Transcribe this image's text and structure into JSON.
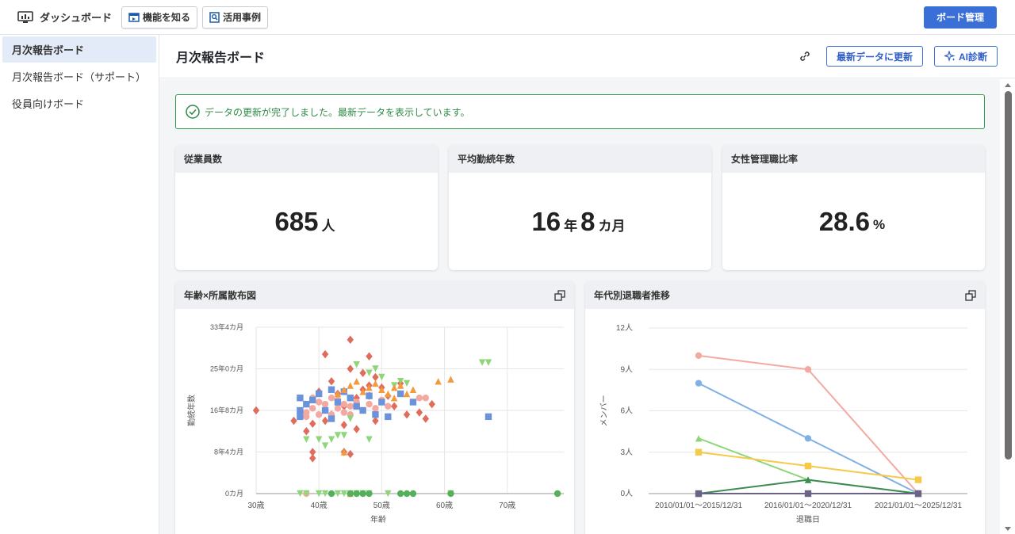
{
  "topbar": {
    "app_title": "ダッシュボード",
    "features_btn": "機能を知る",
    "cases_btn": "活用事例",
    "manage_btn": "ボード管理"
  },
  "sidebar": {
    "items": [
      {
        "label": "月次報告ボード",
        "active": true
      },
      {
        "label": "月次報告ボード（サポート）",
        "active": false
      },
      {
        "label": "役員向けボード",
        "active": false
      }
    ]
  },
  "main": {
    "title": "月次報告ボード",
    "refresh_btn": "最新データに更新",
    "ai_btn": "AI診断",
    "notice": "データの更新が完了しました。最新データを表示しています。"
  },
  "kpis": [
    {
      "title": "従業員数",
      "value": "685",
      "unit": "人"
    },
    {
      "title": "平均勤続年数",
      "value1": "16",
      "unit1": "年",
      "value2": "8",
      "unit2": "カ月"
    },
    {
      "title": "女性管理職比率",
      "value": "28.6",
      "unit": "%"
    }
  ],
  "colors": {
    "accent": "#3a6fd8",
    "success": "#2e9a4a"
  },
  "chart_data": [
    {
      "type": "scatter",
      "title": "年齢×所属散布図",
      "xlabel": "年齢",
      "ylabel": "勤続年数",
      "xlim": [
        30,
        79
      ],
      "ylim": [
        0,
        400
      ],
      "x_ticks": [
        {
          "v": 30,
          "label": "30歳"
        },
        {
          "v": 40,
          "label": "40歳"
        },
        {
          "v": 50,
          "label": "50歳"
        },
        {
          "v": 60,
          "label": "60歳"
        },
        {
          "v": 70,
          "label": "70歳"
        }
      ],
      "y_ticks": [
        {
          "v": 0,
          "label": "0カ月"
        },
        {
          "v": 100,
          "label": "8年4カ月"
        },
        {
          "v": 200,
          "label": "16年8カ月"
        },
        {
          "v": 300,
          "label": "25年0カ月"
        },
        {
          "v": 400,
          "label": "33年4カ月"
        }
      ],
      "series": [
        {
          "color": "#e06d5c",
          "marker": "diamond",
          "points": [
            [
              30,
              200
            ],
            [
              36,
              175
            ],
            [
              38,
              150
            ],
            [
              39,
              168
            ],
            [
              40,
              245
            ],
            [
              41,
              335
            ],
            [
              41,
              175
            ],
            [
              42,
              270
            ],
            [
              42,
              190
            ],
            [
              43,
              215
            ],
            [
              44,
              210
            ],
            [
              44,
              100
            ],
            [
              44,
              165
            ],
            [
              45,
              370
            ],
            [
              45,
              300
            ],
            [
              45,
              95
            ],
            [
              46,
              230
            ],
            [
              46,
              155
            ],
            [
              47,
              290
            ],
            [
              47,
              250
            ],
            [
              48,
              330
            ],
            [
              48,
              260
            ],
            [
              49,
              280
            ],
            [
              49,
              175
            ],
            [
              50,
              255
            ],
            [
              51,
              235
            ],
            [
              53,
              265
            ],
            [
              54,
              190
            ],
            [
              56,
              195
            ],
            [
              57,
              180
            ],
            [
              58,
              215
            ],
            [
              48,
              235
            ],
            [
              43,
              240
            ],
            [
              52,
              210
            ],
            [
              39,
              85
            ],
            [
              39,
              100
            ]
          ]
        },
        {
          "color": "#f4a9a0",
          "marker": "circle",
          "points": [
            [
              38,
              195
            ],
            [
              38,
              185
            ],
            [
              39,
              230
            ],
            [
              39,
              205
            ],
            [
              40,
              220
            ],
            [
              40,
              190
            ],
            [
              41,
              215
            ],
            [
              41,
              200
            ],
            [
              42,
              230
            ],
            [
              42,
              190
            ],
            [
              43,
              225
            ],
            [
              43,
              205
            ],
            [
              44,
              215
            ],
            [
              44,
              195
            ],
            [
              45,
              210
            ],
            [
              45,
              190
            ],
            [
              46,
              220
            ],
            [
              47,
              200
            ],
            [
              48,
              215
            ],
            [
              49,
              205
            ],
            [
              50,
              225
            ],
            [
              51,
              210
            ],
            [
              56,
              230
            ],
            [
              57,
              230
            ],
            [
              38,
              0
            ]
          ]
        },
        {
          "color": "#6b93dc",
          "marker": "square",
          "points": [
            [
              37,
              200
            ],
            [
              37,
              185
            ],
            [
              38,
              215
            ],
            [
              39,
              225
            ],
            [
              40,
              240
            ],
            [
              41,
              200
            ],
            [
              42,
              250
            ],
            [
              43,
              220
            ],
            [
              44,
              245
            ],
            [
              45,
              230
            ],
            [
              46,
              210
            ],
            [
              47,
              200
            ],
            [
              48,
              235
            ],
            [
              49,
              190
            ],
            [
              50,
              220
            ],
            [
              51,
              185
            ],
            [
              53,
              240
            ],
            [
              55,
              220
            ],
            [
              67,
              185
            ],
            [
              37,
              230
            ],
            [
              42,
              180
            ]
          ]
        },
        {
          "color": "#8ed67a",
          "marker": "triangle-down",
          "points": [
            [
              37,
              0
            ],
            [
              38,
              0
            ],
            [
              40,
              0
            ],
            [
              41,
              0
            ],
            [
              43,
              0
            ],
            [
              44,
              0
            ],
            [
              45,
              0
            ],
            [
              46,
              0
            ],
            [
              47,
              0
            ],
            [
              48,
              0
            ],
            [
              51,
              0
            ],
            [
              38,
              130
            ],
            [
              40,
              130
            ],
            [
              41,
              115
            ],
            [
              42,
              130
            ],
            [
              43,
              140
            ],
            [
              44,
              140
            ],
            [
              45,
              180
            ],
            [
              46,
              310
            ],
            [
              48,
              290
            ],
            [
              49,
              300
            ],
            [
              50,
              280
            ],
            [
              52,
              260
            ],
            [
              54,
              265
            ],
            [
              48,
              130
            ],
            [
              53,
              270
            ],
            [
              61,
              0
            ],
            [
              66,
              315
            ],
            [
              67,
              315
            ]
          ]
        },
        {
          "color": "#f29a3c",
          "marker": "triangle-up",
          "points": [
            [
              43,
              240
            ],
            [
              44,
              250
            ],
            [
              45,
              260
            ],
            [
              46,
              270
            ],
            [
              47,
              245
            ],
            [
              48,
              255
            ],
            [
              49,
              265
            ],
            [
              50,
              250
            ],
            [
              51,
              240
            ],
            [
              52,
              255
            ],
            [
              53,
              260
            ],
            [
              54,
              240
            ],
            [
              55,
              250
            ],
            [
              59,
              270
            ],
            [
              61,
              275
            ],
            [
              44,
              100
            ],
            [
              45,
              0
            ],
            [
              52,
              230
            ]
          ]
        },
        {
          "color": "#55b05a",
          "marker": "circle",
          "points": [
            [
              42,
              0
            ],
            [
              45,
              0
            ],
            [
              46,
              0
            ],
            [
              47,
              0
            ],
            [
              48,
              0
            ],
            [
              53,
              0
            ],
            [
              54,
              0
            ],
            [
              55,
              0
            ],
            [
              61,
              0
            ],
            [
              78,
              0
            ]
          ]
        }
      ]
    },
    {
      "type": "line",
      "title": "年代別退職者推移",
      "xlabel": "退職日",
      "ylabel": "メンバー",
      "categories": [
        "2010/01/01～2015/12/31",
        "2016/01/01～2020/12/31",
        "2021/01/01～2025/12/31"
      ],
      "ylim": [
        0,
        12
      ],
      "y_ticks": [
        {
          "v": 0,
          "label": "0人"
        },
        {
          "v": 3,
          "label": "3人"
        },
        {
          "v": 6,
          "label": "6人"
        },
        {
          "v": 9,
          "label": "9人"
        },
        {
          "v": 12,
          "label": "12人"
        }
      ],
      "series": [
        {
          "color": "#f4a9a0",
          "marker": "circle",
          "values": [
            10,
            9,
            0
          ]
        },
        {
          "color": "#7fb0e6",
          "marker": "circle",
          "values": [
            8,
            4,
            0
          ]
        },
        {
          "color": "#8ed67a",
          "marker": "triangle",
          "values": [
            4,
            1,
            0
          ]
        },
        {
          "color": "#f7c948",
          "marker": "square",
          "values": [
            3,
            2,
            1
          ]
        },
        {
          "color": "#3d8a55",
          "marker": "triangle",
          "values": [
            0,
            1,
            0
          ]
        },
        {
          "color": "#6b6385",
          "marker": "square",
          "values": [
            0,
            0,
            0
          ]
        }
      ]
    }
  ]
}
